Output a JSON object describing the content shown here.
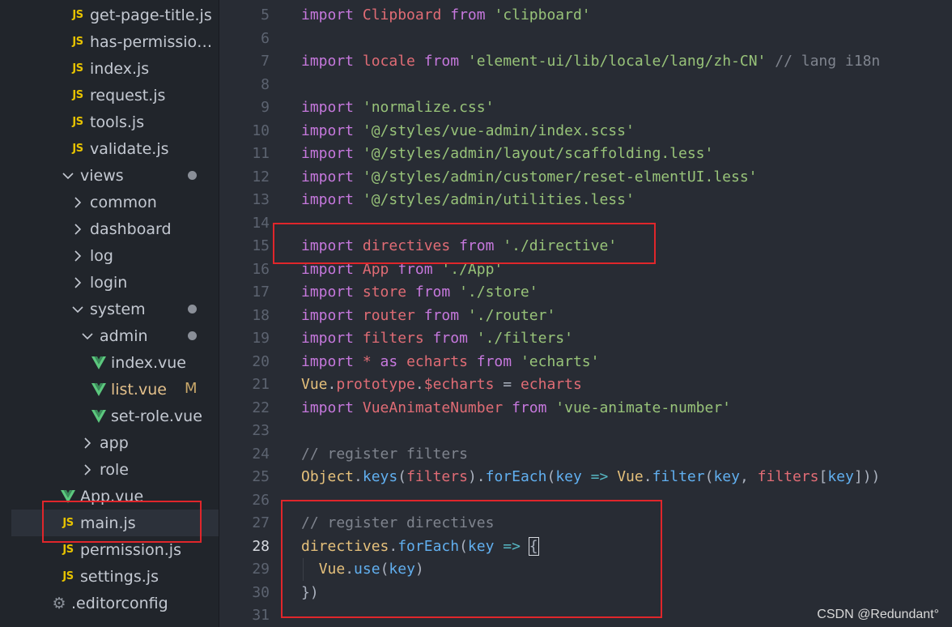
{
  "sidebar": {
    "items": [
      {
        "type": "js",
        "label": "get-page-title.js",
        "indent": 1
      },
      {
        "type": "js",
        "label": "has-permissions...",
        "indent": 1
      },
      {
        "type": "js",
        "label": "index.js",
        "indent": 1
      },
      {
        "type": "js",
        "label": "request.js",
        "indent": 1
      },
      {
        "type": "js",
        "label": "tools.js",
        "indent": 1
      },
      {
        "type": "js",
        "label": "validate.js",
        "indent": 1
      },
      {
        "type": "folder-open",
        "label": "views",
        "indent": 0,
        "dot": true
      },
      {
        "type": "folder",
        "label": "common",
        "indent": 1
      },
      {
        "type": "folder",
        "label": "dashboard",
        "indent": 1
      },
      {
        "type": "folder",
        "label": "log",
        "indent": 1
      },
      {
        "type": "folder",
        "label": "login",
        "indent": 1
      },
      {
        "type": "folder-open",
        "label": "system",
        "indent": 1,
        "dot": true
      },
      {
        "type": "folder-open",
        "label": "admin",
        "indent": 2,
        "dot": true
      },
      {
        "type": "vue",
        "label": "index.vue",
        "indent": 3
      },
      {
        "type": "vue",
        "label": "list.vue",
        "indent": 3,
        "status": "M",
        "modified": true
      },
      {
        "type": "vue",
        "label": "set-role.vue",
        "indent": 3
      },
      {
        "type": "folder",
        "label": "app",
        "indent": 2
      },
      {
        "type": "folder",
        "label": "role",
        "indent": 2
      },
      {
        "type": "vue",
        "label": "App.vue",
        "indent": 0
      },
      {
        "type": "js",
        "label": "main.js",
        "indent": 0,
        "selected": true
      },
      {
        "type": "js",
        "label": "permission.js",
        "indent": 0
      },
      {
        "type": "js",
        "label": "settings.js",
        "indent": 0
      },
      {
        "type": "gear",
        "label": ".editorconfig",
        "indent": -1
      }
    ],
    "icons": {
      "js": "JS",
      "vue": "V",
      "chevron_right": "›",
      "chevron_down": "⌄",
      "gear": "⚙"
    }
  },
  "editor": {
    "active_line": "28",
    "lines": [
      {
        "n": "5",
        "tokens": [
          [
            "kw",
            "import "
          ],
          [
            "var",
            "Clipboard"
          ],
          [
            "kw",
            " from "
          ],
          [
            "str",
            "'clipboard'"
          ]
        ]
      },
      {
        "n": "6",
        "tokens": []
      },
      {
        "n": "7",
        "tokens": [
          [
            "kw",
            "import "
          ],
          [
            "var",
            "locale"
          ],
          [
            "kw",
            " from "
          ],
          [
            "str",
            "'element-ui/lib/locale/lang/zh-CN'"
          ],
          [
            "com",
            " // lang i18n"
          ]
        ]
      },
      {
        "n": "8",
        "tokens": []
      },
      {
        "n": "9",
        "tokens": [
          [
            "kw",
            "import "
          ],
          [
            "str",
            "'normalize.css'"
          ]
        ]
      },
      {
        "n": "10",
        "tokens": [
          [
            "kw",
            "import "
          ],
          [
            "str",
            "'@/styles/vue-admin/index.scss'"
          ]
        ]
      },
      {
        "n": "11",
        "tokens": [
          [
            "kw",
            "import "
          ],
          [
            "str",
            "'@/styles/admin/layout/scaffolding.less'"
          ]
        ]
      },
      {
        "n": "12",
        "tokens": [
          [
            "kw",
            "import "
          ],
          [
            "str",
            "'@/styles/admin/customer/reset-elmentUI.less'"
          ]
        ]
      },
      {
        "n": "13",
        "tokens": [
          [
            "kw",
            "import "
          ],
          [
            "str",
            "'@/styles/admin/utilities.less'"
          ]
        ]
      },
      {
        "n": "14",
        "tokens": []
      },
      {
        "n": "15",
        "tokens": [
          [
            "kw",
            "import "
          ],
          [
            "var",
            "directives"
          ],
          [
            "kw",
            " from "
          ],
          [
            "str",
            "'./directive'"
          ]
        ]
      },
      {
        "n": "16",
        "tokens": [
          [
            "kw",
            "import "
          ],
          [
            "var",
            "App"
          ],
          [
            "kw",
            " from "
          ],
          [
            "str",
            "'./App'"
          ]
        ]
      },
      {
        "n": "17",
        "tokens": [
          [
            "kw",
            "import "
          ],
          [
            "var",
            "store"
          ],
          [
            "kw",
            " from "
          ],
          [
            "str",
            "'./store'"
          ]
        ]
      },
      {
        "n": "18",
        "tokens": [
          [
            "kw",
            "import "
          ],
          [
            "var",
            "router"
          ],
          [
            "kw",
            " from "
          ],
          [
            "str",
            "'./router'"
          ]
        ]
      },
      {
        "n": "19",
        "tokens": [
          [
            "kw",
            "import "
          ],
          [
            "var",
            "filters"
          ],
          [
            "kw",
            " from "
          ],
          [
            "str",
            "'./filters'"
          ]
        ]
      },
      {
        "n": "20",
        "tokens": [
          [
            "kw",
            "import "
          ],
          [
            "var",
            "*"
          ],
          [
            "kw",
            " as "
          ],
          [
            "var",
            "echarts"
          ],
          [
            "kw",
            " from "
          ],
          [
            "str",
            "'echarts'"
          ]
        ]
      },
      {
        "n": "21",
        "tokens": [
          [
            "cls",
            "Vue"
          ],
          [
            "txt",
            "."
          ],
          [
            "var",
            "prototype"
          ],
          [
            "txt",
            "."
          ],
          [
            "var",
            "$echarts"
          ],
          [
            "txt",
            " = "
          ],
          [
            "var",
            "echarts"
          ]
        ]
      },
      {
        "n": "22",
        "tokens": [
          [
            "kw",
            "import "
          ],
          [
            "var",
            "VueAnimateNumber"
          ],
          [
            "kw",
            " from "
          ],
          [
            "str",
            "'vue-animate-number'"
          ]
        ]
      },
      {
        "n": "23",
        "tokens": []
      },
      {
        "n": "24",
        "tokens": [
          [
            "com",
            "// register filters"
          ]
        ]
      },
      {
        "n": "25",
        "tokens": [
          [
            "cls",
            "Object"
          ],
          [
            "txt",
            "."
          ],
          [
            "fn",
            "keys"
          ],
          [
            "txt",
            "("
          ],
          [
            "var",
            "filters"
          ],
          [
            "txt",
            ")."
          ],
          [
            "fn",
            "forEach"
          ],
          [
            "txt",
            "("
          ],
          [
            "fn",
            "key"
          ],
          [
            "op",
            " => "
          ],
          [
            "cls",
            "Vue"
          ],
          [
            "txt",
            "."
          ],
          [
            "fn",
            "filter"
          ],
          [
            "txt",
            "("
          ],
          [
            "fn",
            "key"
          ],
          [
            "txt",
            ", "
          ],
          [
            "var",
            "filters"
          ],
          [
            "txt",
            "["
          ],
          [
            "fn",
            "key"
          ],
          [
            "txt",
            "]))"
          ]
        ]
      },
      {
        "n": "26",
        "tokens": []
      },
      {
        "n": "27",
        "tokens": [
          [
            "com",
            "// register directives"
          ]
        ]
      },
      {
        "n": "28",
        "tokens": [
          [
            "cls",
            "directives"
          ],
          [
            "txt",
            "."
          ],
          [
            "fn",
            "forEach"
          ],
          [
            "txt",
            "("
          ],
          [
            "fn",
            "key"
          ],
          [
            "op",
            " => "
          ],
          [
            "cur",
            "{"
          ]
        ]
      },
      {
        "n": "29",
        "tokens": [
          [
            "txt",
            "  "
          ],
          [
            "cls",
            "Vue"
          ],
          [
            "txt",
            "."
          ],
          [
            "fn",
            "use"
          ],
          [
            "txt",
            "("
          ],
          [
            "fn",
            "key"
          ],
          [
            "txt",
            ")"
          ]
        ]
      },
      {
        "n": "30",
        "tokens": [
          [
            "txt",
            "})"
          ]
        ]
      },
      {
        "n": "31",
        "tokens": []
      }
    ]
  },
  "watermark": "CSDN @Redundant°",
  "colors": {
    "highlight_box": "#e0262b",
    "editor_bg": "#282c34",
    "sidebar_bg": "#21252b"
  }
}
